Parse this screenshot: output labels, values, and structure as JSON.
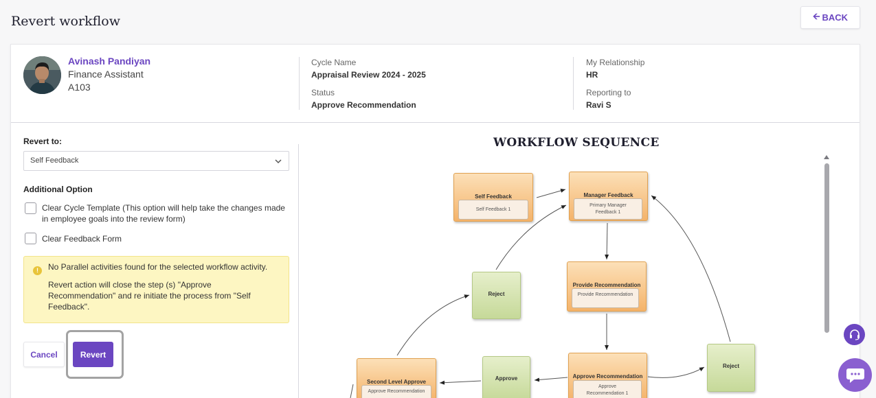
{
  "page": {
    "title": "Revert workflow",
    "back_label": "BACK"
  },
  "employee": {
    "name": "Avinash Pandiyan",
    "role": "Finance Assistant",
    "id": "A103"
  },
  "info": {
    "cycle_name_label": "Cycle Name",
    "cycle_name_value": "Appraisal Review 2024 - 2025",
    "status_label": "Status",
    "status_value": "Approve Recommendation",
    "relationship_label": "My Relationship",
    "relationship_value": "HR",
    "reporting_label": "Reporting to",
    "reporting_value": "Ravi S"
  },
  "form": {
    "revert_to_label": "Revert to:",
    "revert_to_value": "Self Feedback",
    "additional_option_label": "Additional Option",
    "option_clear_cycle": "Clear Cycle Template (This option will help take the changes made in employee goals into the review form)",
    "option_clear_feedback": "Clear Feedback Form",
    "alert_line1": "No Parallel activities found for the selected workflow activity.",
    "alert_line2": "Revert action will close the step (s) \"Approve Recommendation\" and re initiate the process from \"Self Feedback\".",
    "cancel_label": "Cancel",
    "revert_label": "Revert"
  },
  "workflow": {
    "title": "WORKFLOW SEQUENCE",
    "nodes": {
      "self_feedback": {
        "title": "Self Feedback",
        "sub": "Self Feedback 1"
      },
      "manager_feedback": {
        "title": "Manager Feedback",
        "sub": "Primary Manager Feedback 1"
      },
      "reject_1": {
        "title": "Reject"
      },
      "provide_recommendation": {
        "title": "Provide Recommendation",
        "sub": "Provide Recommendation"
      },
      "second_level_approve": {
        "title": "Second Level Approve",
        "sub": "Approve Recommendation"
      },
      "approve": {
        "title": "Approve"
      },
      "approve_recommendation": {
        "title": "Approve Recommendation",
        "sub": "Approve Recommendation 1"
      },
      "reject_2": {
        "title": "Reject"
      }
    }
  },
  "colors": {
    "accent": "#6b46c1",
    "alert_bg": "#fdf6c2"
  }
}
